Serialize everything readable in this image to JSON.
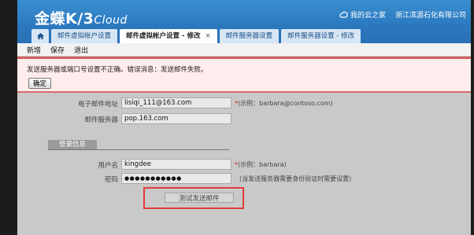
{
  "header": {
    "logo_main": "金蝶K/3",
    "logo_cloud": "Cloud",
    "my_cloud_home": "我的云之家",
    "company": "浙江滨源石化有限公司"
  },
  "tabs": [
    {
      "label": "邮件虚拟帐户设置"
    },
    {
      "label": "邮件虚拟帐户设置 - 修改",
      "close": "×"
    },
    {
      "label": "邮件服务器设置"
    },
    {
      "label": "邮件服务器设置 - 修改"
    }
  ],
  "toolbar": {
    "new": "新增",
    "save": "保存",
    "exit": "退出"
  },
  "alert": {
    "message": "发送服务器或端口号设置不正确。错误消息：发送邮件失败。",
    "ok": "确定"
  },
  "form": {
    "email_label": "电子邮件地址",
    "email_value": "lisiqi_111@163.com",
    "email_hint": "(示例：barbara@contoso.com)",
    "server_label": "邮件服务器",
    "server_value": "pop.163.com",
    "login_section": "登录信息",
    "username_label": "用户名",
    "username_value": "kingdee",
    "username_hint": "(示例：barbara)",
    "password_label": "密码",
    "password_value": "●●●●●●●●●●●",
    "password_hint": "(当发送服务器需要身份验证时需要设置)",
    "required_mark": "*",
    "send_test": "测试发送邮件"
  }
}
